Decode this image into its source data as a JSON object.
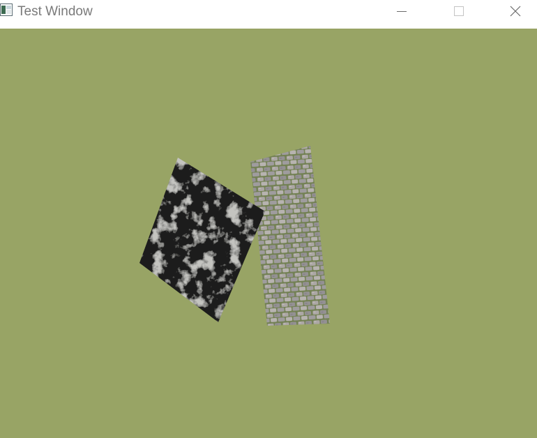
{
  "window": {
    "title": "Test Window",
    "background_color": "#98a465",
    "icons": {
      "app": "window-app-icon",
      "minimize": "minimize-icon",
      "maximize": "maximize-icon",
      "close": "close-icon"
    }
  },
  "scene": {
    "quads": [
      {
        "name": "dark-marble-quad",
        "texture": "dark-marble",
        "base_color": "#1e1f1d"
      },
      {
        "name": "cobblestone-quad",
        "texture": "cobblestone",
        "base_color": "#8f8c88"
      }
    ]
  }
}
